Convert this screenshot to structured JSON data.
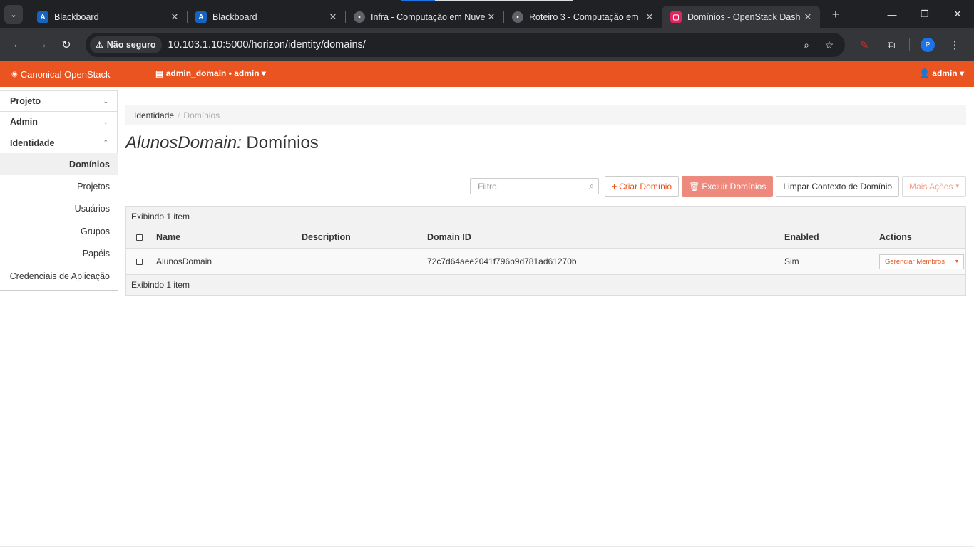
{
  "browser": {
    "tabs": [
      {
        "title": "Blackboard",
        "favicon": "blackboard-icon",
        "color": "#1565c0"
      },
      {
        "title": "Blackboard",
        "favicon": "blackboard-icon",
        "color": "#1565c0"
      },
      {
        "title": "Infra - Computação em Nuvem",
        "favicon": "book-icon",
        "color": "#5f6368"
      },
      {
        "title": "Roteiro 3 - Computação em",
        "favicon": "book-icon",
        "color": "#5f6368"
      },
      {
        "title": "Domínios - OpenStack Dashboard",
        "favicon": "openstack-icon",
        "color": "#e0245e"
      }
    ],
    "security_label": "Não seguro",
    "url": "10.103.1.10:5000/horizon/identity/domains/",
    "profile_initial": "P"
  },
  "header": {
    "brand": "Canonical OpenStack",
    "context": "admin_domain • admin",
    "user": "admin",
    "accent": "#e95420"
  },
  "sidebar": {
    "panels": [
      {
        "label": "Projeto"
      },
      {
        "label": "Admin"
      },
      {
        "label": "Identidade"
      }
    ],
    "items": [
      {
        "label": "Domínios",
        "active": true
      },
      {
        "label": "Projetos"
      },
      {
        "label": "Usuários"
      },
      {
        "label": "Grupos"
      },
      {
        "label": "Papéis"
      },
      {
        "label": "Credenciais de Aplicação"
      }
    ]
  },
  "breadcrumb": {
    "root": "Identidade",
    "sep": "/",
    "current": "Domínios"
  },
  "page": {
    "title_italic": "AlunosDomain:",
    "title": "Domínios"
  },
  "actions": {
    "filter_placeholder": "Filtro",
    "create": "Criar Domínio",
    "delete": "Excluir Domínios",
    "clear": "Limpar Contexto de Domínio",
    "more": "Mais Ações"
  },
  "table": {
    "summary": "Exibindo 1 item",
    "columns": {
      "name": "Name",
      "description": "Description",
      "domain_id": "Domain ID",
      "enabled": "Enabled",
      "actions": "Actions"
    },
    "rows": [
      {
        "name": "AlunosDomain",
        "description": "",
        "domain_id": "72c7d64aee2041f796b9d781ad61270b",
        "enabled": "Sim",
        "action": "Gerenciar Membros"
      }
    ],
    "footer": "Exibindo 1 item"
  }
}
